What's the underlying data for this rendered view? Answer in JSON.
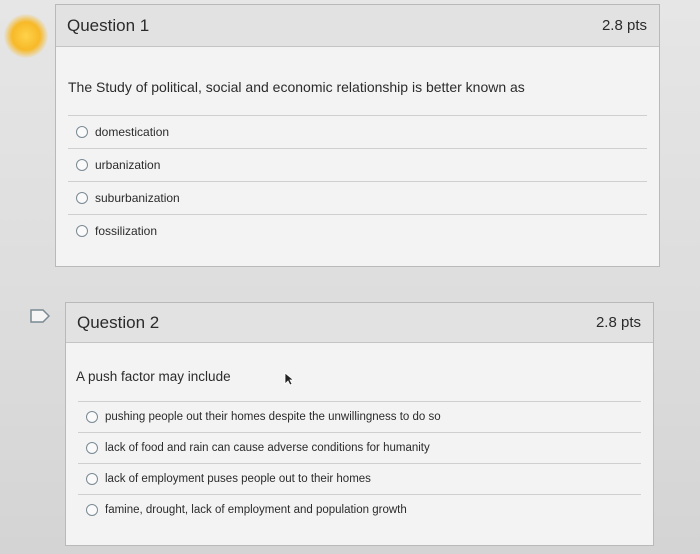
{
  "questions": [
    {
      "title": "Question 1",
      "points": "2.8 pts",
      "prompt": "The Study of political, social and economic relationship is better known as",
      "answers": [
        "domestication",
        "urbanization",
        "suburbanization",
        "fossilization"
      ]
    },
    {
      "title": "Question 2",
      "points": "2.8 pts",
      "prompt": "A push factor may include",
      "answers": [
        "pushing people out their homes despite the unwillingness to do so",
        "lack of food and rain can cause adverse conditions for humanity",
        "lack of employment puses people out to their homes",
        "famine, drought, lack of employment and population growth"
      ]
    }
  ],
  "colors": {
    "highlight": "#f7b928",
    "flag": "#7a8a94"
  }
}
